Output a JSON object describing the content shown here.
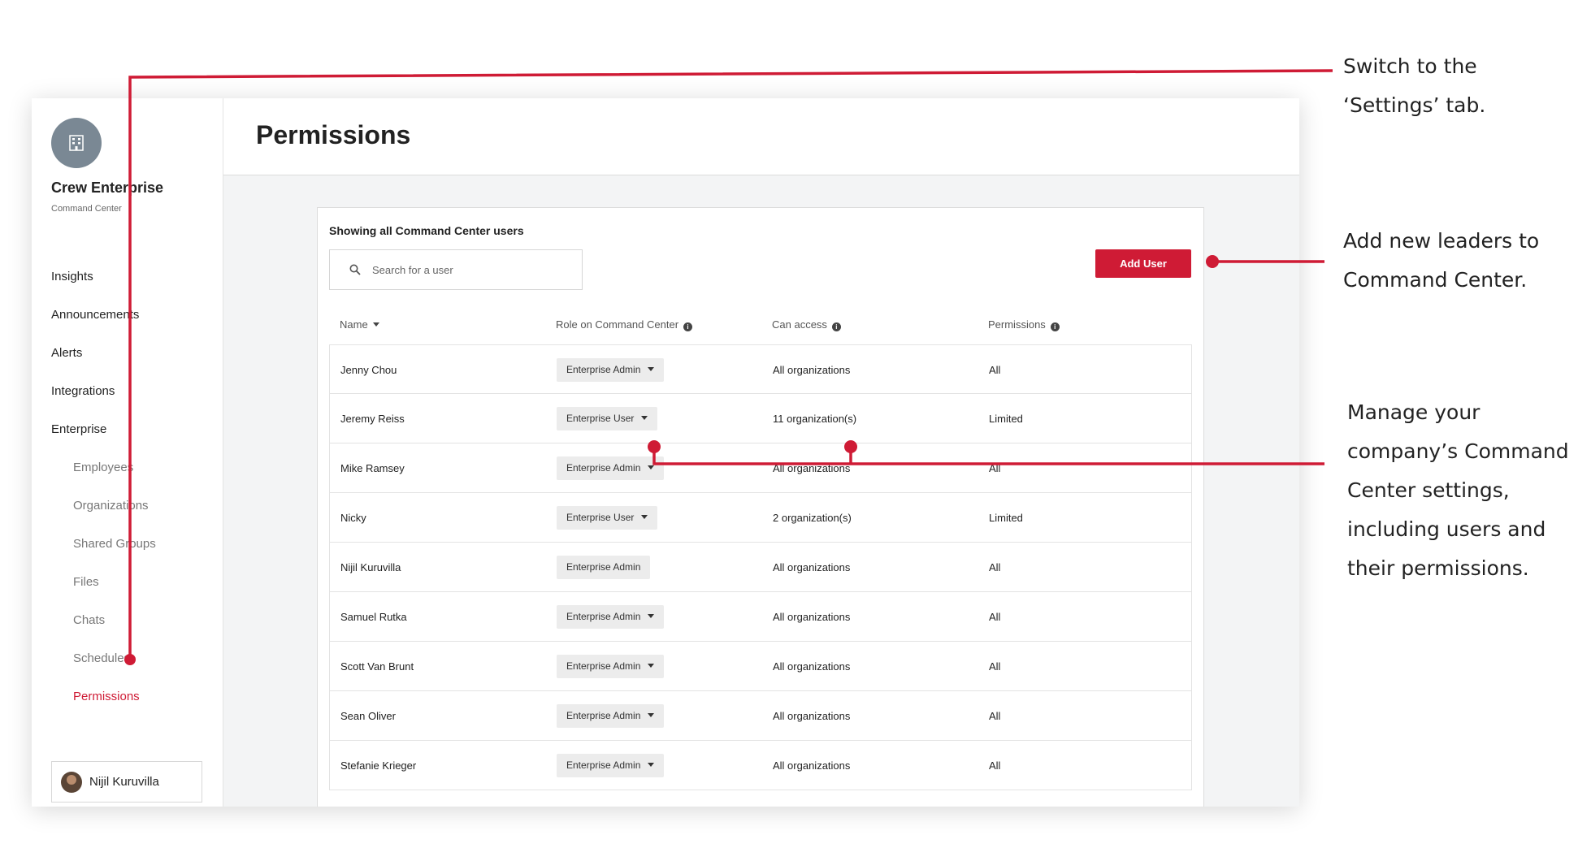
{
  "sidebar": {
    "org_name": "Crew Enterprise",
    "org_sub": "Command Center",
    "items": [
      {
        "label": "Insights"
      },
      {
        "label": "Announcements"
      },
      {
        "label": "Alerts"
      },
      {
        "label": "Integrations"
      },
      {
        "label": "Enterprise"
      }
    ],
    "sub_items": [
      {
        "label": "Employees"
      },
      {
        "label": "Organizations"
      },
      {
        "label": "Shared Groups"
      },
      {
        "label": "Files"
      },
      {
        "label": "Chats"
      },
      {
        "label": "Schedules"
      },
      {
        "label": "Permissions",
        "active": true
      }
    ],
    "profile_name": "Nijil Kuruvilla"
  },
  "main": {
    "title": "Permissions",
    "panel_title": "Showing all Command Center users",
    "search_placeholder": "Search for a user",
    "add_user_label": "Add User",
    "columns": {
      "name": "Name",
      "role": "Role on Command Center",
      "access": "Can access",
      "permissions": "Permissions"
    },
    "rows": [
      {
        "name": "Jenny Chou",
        "role": "Enterprise Admin",
        "dropdown": true,
        "access": "All organizations",
        "permissions": "All"
      },
      {
        "name": "Jeremy Reiss",
        "role": "Enterprise User",
        "dropdown": true,
        "access": "11 organization(s)",
        "permissions": "Limited"
      },
      {
        "name": "Mike Ramsey",
        "role": "Enterprise Admin",
        "dropdown": true,
        "access": "All organizations",
        "permissions": "All"
      },
      {
        "name": "Nicky",
        "role": "Enterprise User",
        "dropdown": true,
        "access": "2 organization(s)",
        "permissions": "Limited"
      },
      {
        "name": "Nijil Kuruvilla",
        "role": "Enterprise Admin",
        "dropdown": false,
        "access": "All organizations",
        "permissions": "All"
      },
      {
        "name": "Samuel Rutka",
        "role": "Enterprise Admin",
        "dropdown": true,
        "access": "All organizations",
        "permissions": "All"
      },
      {
        "name": "Scott Van Brunt",
        "role": "Enterprise Admin",
        "dropdown": true,
        "access": "All organizations",
        "permissions": "All"
      },
      {
        "name": "Sean Oliver",
        "role": "Enterprise Admin",
        "dropdown": true,
        "access": "All organizations",
        "permissions": "All"
      },
      {
        "name": "Stefanie Krieger",
        "role": "Enterprise Admin",
        "dropdown": true,
        "access": "All organizations",
        "permissions": "All"
      }
    ]
  },
  "annotations": {
    "settings": [
      "Switch to the",
      "‘Settings’ tab."
    ],
    "add_leaders": [
      "Add new leaders to",
      "Command Center."
    ],
    "manage": [
      "Manage your",
      "company’s Command",
      "Center settings,",
      "including users and",
      "their permissions."
    ]
  },
  "colors": {
    "accent": "#cf1b35",
    "org_avatar": "#7a8894"
  },
  "icons": {
    "org": "building-icon",
    "search": "search-icon",
    "info": "info-icon",
    "sort": "caret-down-icon"
  }
}
